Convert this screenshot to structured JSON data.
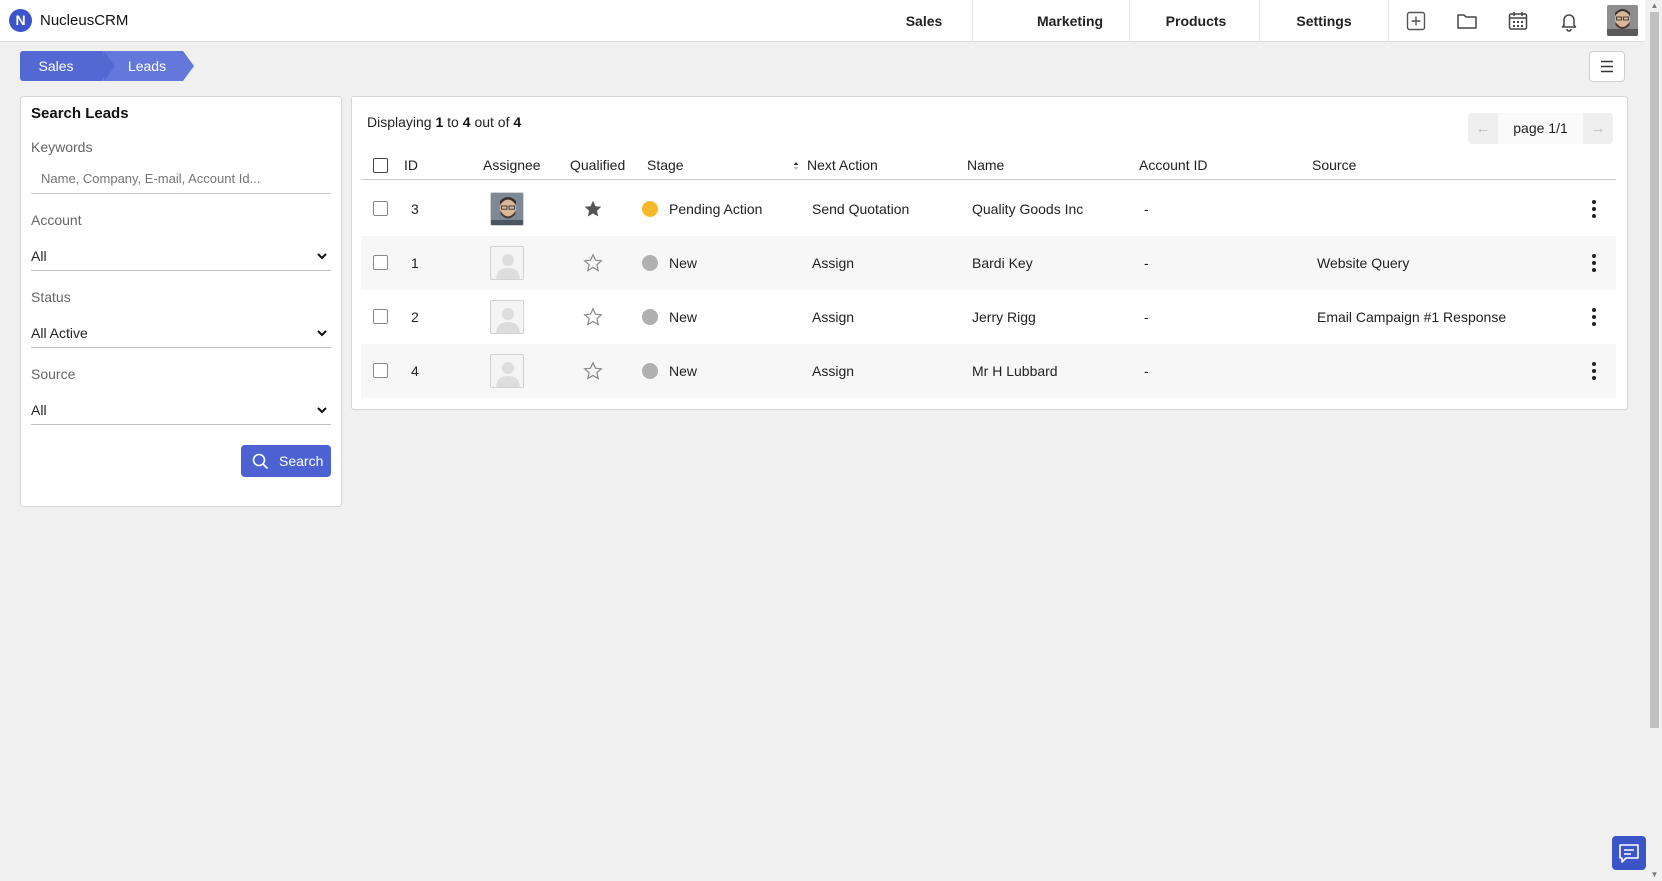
{
  "app": {
    "logo_letter": "N",
    "name": "NucleusCRM"
  },
  "nav": {
    "items": [
      "Sales",
      "Marketing",
      "Products",
      "Settings"
    ],
    "icons": [
      "add-icon",
      "folder-icon",
      "calendar-icon",
      "bell-icon"
    ]
  },
  "breadcrumb": [
    "Sales",
    "Leads"
  ],
  "search_panel": {
    "title": "Search Leads",
    "keywords_label": "Keywords",
    "keywords_placeholder": "Name, Company, E-mail, Account Id...",
    "keywords_value": "",
    "account_label": "Account",
    "account_value": "All",
    "status_label": "Status",
    "status_value": "All Active",
    "source_label": "Source",
    "source_value": "All",
    "search_button": "Search"
  },
  "results": {
    "display_prefix": "Displaying",
    "display_from": "1",
    "display_to_word": "to",
    "display_to": "4",
    "display_of_word": "out of",
    "display_total": "4",
    "page_label": "page 1/1",
    "columns": [
      "ID",
      "Assignee",
      "Qualified",
      "Stage",
      "Next Action",
      "Name",
      "Account ID",
      "Source"
    ],
    "rows": [
      {
        "id": "3",
        "assignee_photo": true,
        "qualified": true,
        "stage": "Pending Action",
        "stage_color": "#f9b82b",
        "next_action": "Send Quotation",
        "name": "Quality Goods Inc",
        "account_id": "-",
        "source": ""
      },
      {
        "id": "1",
        "assignee_photo": false,
        "qualified": false,
        "stage": "New",
        "stage_color": "#b0b0b0",
        "next_action": "Assign",
        "name": "Bardi Key",
        "account_id": "-",
        "source": "Website Query"
      },
      {
        "id": "2",
        "assignee_photo": false,
        "qualified": false,
        "stage": "New",
        "stage_color": "#b0b0b0",
        "next_action": "Assign",
        "name": "Jerry Rigg",
        "account_id": "-",
        "source": "Email Campaign #1 Response"
      },
      {
        "id": "4",
        "assignee_photo": false,
        "qualified": false,
        "stage": "New",
        "stage_color": "#b0b0b0",
        "next_action": "Assign",
        "name": "Mr H Lubbard",
        "account_id": "-",
        "source": ""
      }
    ]
  },
  "colors": {
    "accent": "#4c62d3",
    "brand": "#3b55c9",
    "pending": "#f9b82b",
    "new": "#b0b0b0"
  }
}
